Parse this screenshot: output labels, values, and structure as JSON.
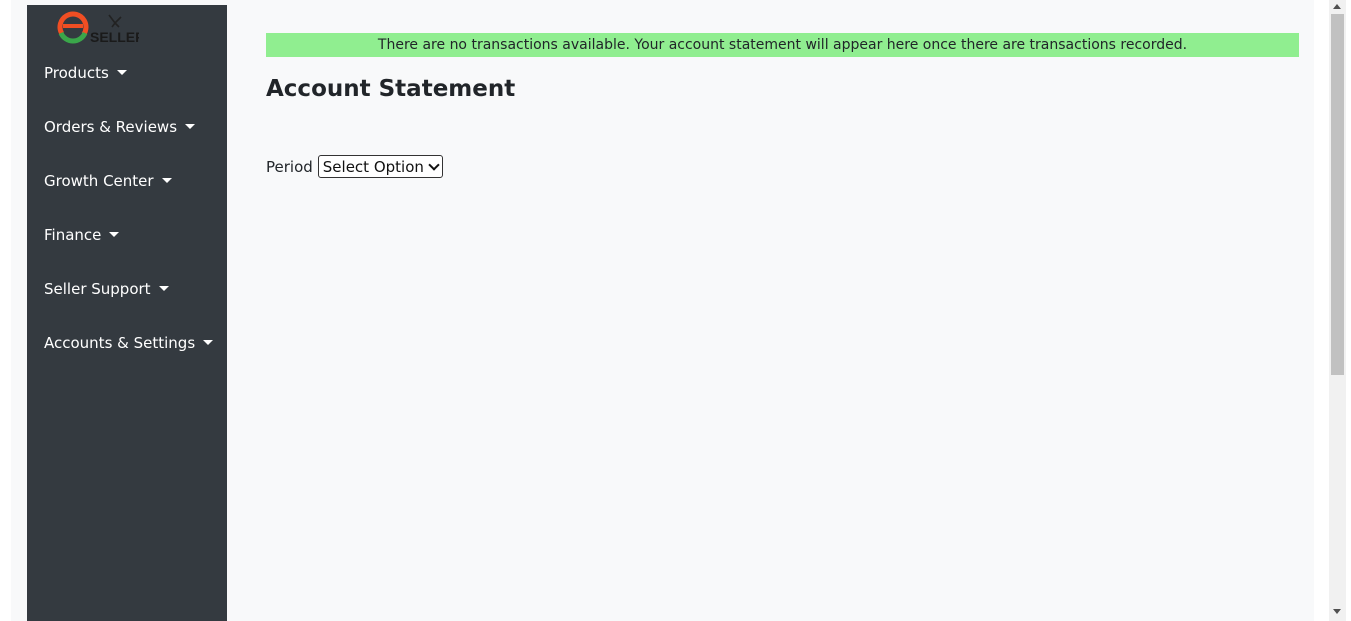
{
  "logo": {
    "text": "SELLER"
  },
  "sidebar": {
    "items": [
      {
        "label": "Products"
      },
      {
        "label": "Orders & Reviews"
      },
      {
        "label": "Growth Center"
      },
      {
        "label": "Finance"
      },
      {
        "label": "Seller Support"
      },
      {
        "label": "Accounts & Settings"
      }
    ]
  },
  "alert": {
    "text": "There are no transactions available. Your account statement will appear here once there are transactions recorded.",
    "color": "#90ee90"
  },
  "page": {
    "title": "Account Statement"
  },
  "period": {
    "label": "Period",
    "selected": "Select Option"
  },
  "colors": {
    "sidebar_bg": "#343a40",
    "page_bg": "#f8f9fa"
  }
}
